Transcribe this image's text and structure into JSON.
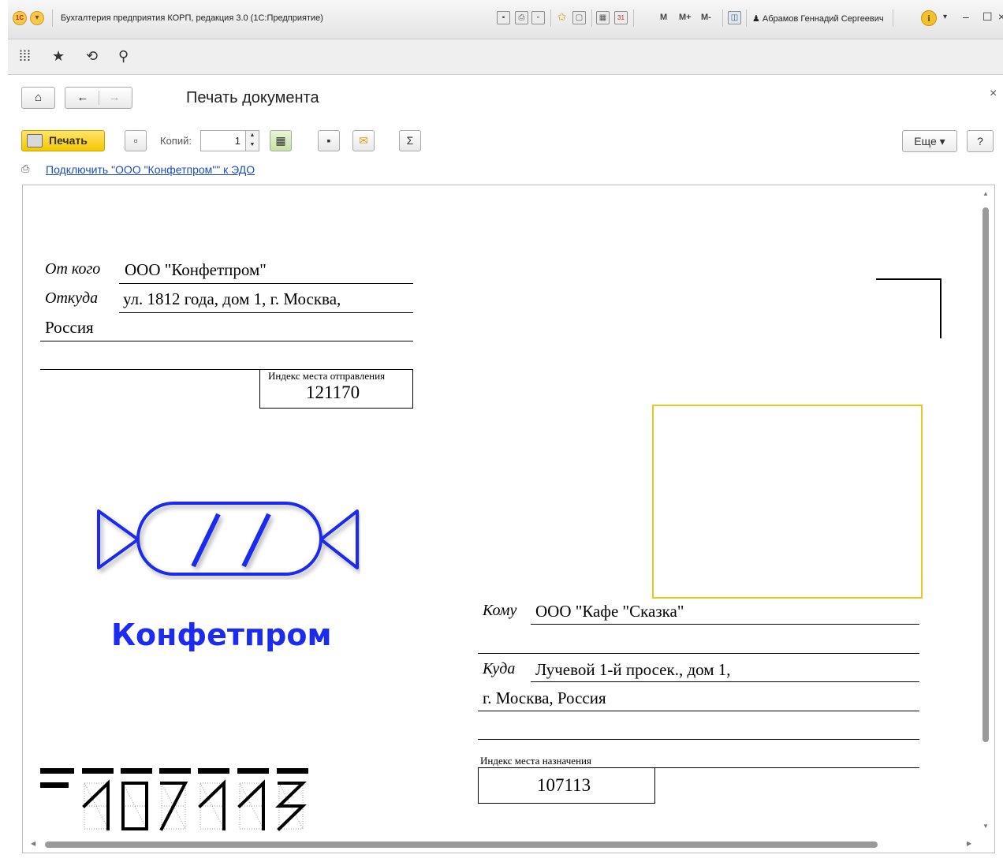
{
  "window": {
    "title": "Бухгалтерия предприятия КОРП, редакция 3.0  (1С:Предприятие)",
    "mem_labels": [
      "M",
      "M+",
      "M-"
    ],
    "user": "Абрамов Геннадий Сергеевич"
  },
  "form": {
    "title": "Печать документа",
    "close": "×"
  },
  "toolbar": {
    "print_label": "Печать",
    "copies_label": "Копий:",
    "copies_value": "1",
    "sum_label": "Σ",
    "more_label": "Еще ▾",
    "help_label": "?"
  },
  "edo_link": "Подключить \"ООО \"Конфетпром\"\" к ЭДО",
  "envelope": {
    "from_label": "От кого",
    "from_value": "ООО \"Конфетпром\"",
    "from_addr_label": "Откуда",
    "from_addr_line1": "ул. 1812 года, дом 1, г. Москва,",
    "from_addr_line2": "Россия",
    "origin_index_caption": "Индекс места отправления",
    "origin_index": "121170",
    "brand": "Конфетпром",
    "to_label": "Кому",
    "to_value": "ООО \"Кафе \"Сказка\"",
    "to_addr_label": "Куда",
    "to_addr_line1": "Лучевой 1-й просек., дом 1,",
    "to_addr_line2": "г. Москва, Россия",
    "dest_index_caption": "Индекс места назначения",
    "dest_index": "107113"
  },
  "colors": {
    "accent_yellow": "#f5c800",
    "stamp_border": "#f2c31b",
    "logo_blue": "#1c2bf0",
    "link_blue": "#1a4ec0"
  }
}
